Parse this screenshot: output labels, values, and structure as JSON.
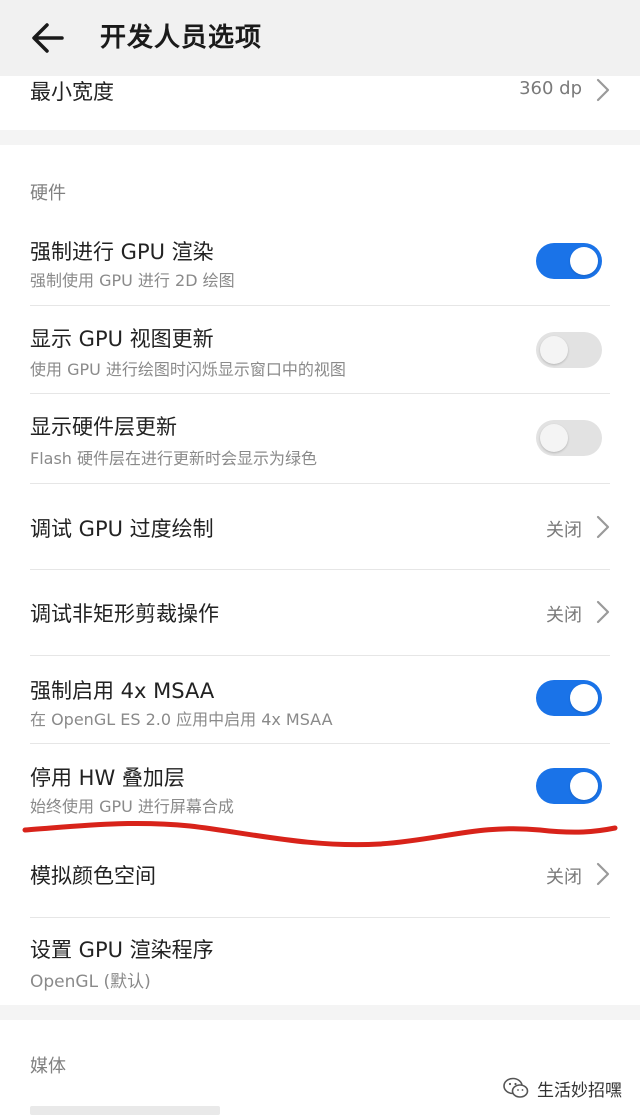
{
  "header": {
    "title": "开发人员选项"
  },
  "top_card": {
    "label": "最小宽度",
    "value": "360 dp"
  },
  "hardware": {
    "section_label": "硬件",
    "items": [
      {
        "title": "强制进行 GPU 渲染",
        "subtitle": "强制使用 GPU 进行 2D 绘图",
        "toggle": "on"
      },
      {
        "title": "显示 GPU 视图更新",
        "subtitle": "使用 GPU 进行绘图时闪烁显示窗口中的视图",
        "toggle": "off"
      },
      {
        "title": "显示硬件层更新",
        "subtitle": "Flash 硬件层在进行更新时会显示为绿色",
        "toggle": "off"
      },
      {
        "title": "调试 GPU 过度绘制",
        "value": "关闭"
      },
      {
        "title": "调试非矩形剪裁操作",
        "value": "关闭"
      },
      {
        "title": "强制启用 4x MSAA",
        "subtitle": "在 OpenGL ES 2.0 应用中启用 4x MSAA",
        "toggle": "on"
      },
      {
        "title": "停用 HW 叠加层",
        "subtitle": "始终使用 GPU 进行屏幕合成",
        "toggle": "on"
      },
      {
        "title": "模拟颜色空间",
        "value": "关闭"
      },
      {
        "title": "设置 GPU 渲染程序",
        "subtitle": "OpenGL (默认)"
      }
    ]
  },
  "media": {
    "section_label": "媒体"
  },
  "watermark": {
    "text": "生活妙招嘿"
  },
  "colors": {
    "accent": "#1a73e8",
    "annotation": "#d8231a"
  }
}
